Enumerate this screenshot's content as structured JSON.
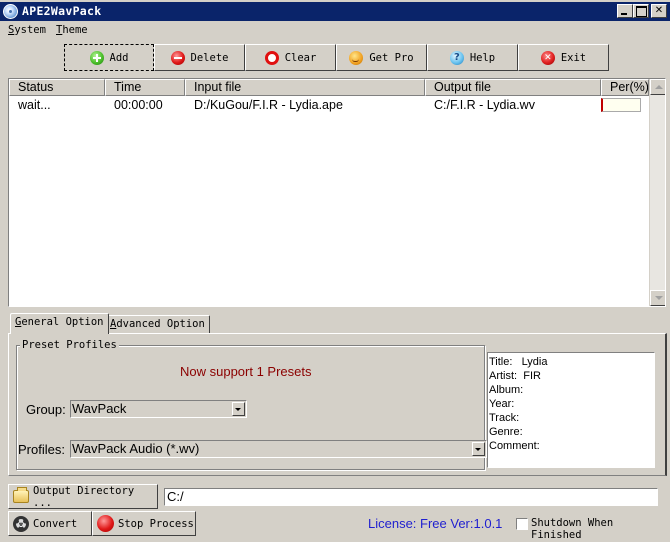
{
  "window": {
    "title": "APE2WavPack",
    "controls": {
      "minimize": "",
      "maximize": "",
      "close": "✕"
    }
  },
  "menu": [
    {
      "label": "System",
      "accel": "S",
      "rest": "ystem"
    },
    {
      "label": "Theme",
      "accel": "T",
      "rest": "heme"
    }
  ],
  "toolbar": {
    "buttons": [
      {
        "label": "Add",
        "icon": "add-icon"
      },
      {
        "label": "Delete",
        "icon": "delete-icon"
      },
      {
        "label": "Clear",
        "icon": "clear-icon"
      },
      {
        "label": "Get Pro",
        "icon": "smiley-icon"
      },
      {
        "label": "Help",
        "icon": "help-icon",
        "glyph": "?"
      },
      {
        "label": "Exit",
        "icon": "exit-icon",
        "glyph": "✕"
      }
    ]
  },
  "file_list": {
    "columns": [
      "Status",
      "Time",
      "Input file",
      "Output file",
      "Per(%)"
    ],
    "rows": [
      {
        "status": "wait...",
        "time": "00:00:00",
        "input": "D:/KuGou/F.I.R - Lydia.ape",
        "output": "C:/F.I.R - Lydia.wv",
        "percent": 0
      }
    ]
  },
  "tabs": [
    {
      "label": "General Option",
      "accel": "G",
      "rest": "eneral Option",
      "active": true
    },
    {
      "label": "Advanced Option",
      "accel": "A",
      "rest": "dvanced Option",
      "active": false
    }
  ],
  "presets": {
    "group_label": "Preset Profiles",
    "note": "Now support 1 Presets",
    "group_field_label": "Group:",
    "group_value": "WavPack",
    "profiles_field_label": "Profiles:",
    "profiles_value": "WavPack Audio (*.wv)"
  },
  "metadata": {
    "lines": [
      "Title:   Lydia",
      "Artist:  FIR",
      "Album:",
      "Year:",
      "Track:",
      "Genre:",
      "Comment:"
    ]
  },
  "bottom": {
    "output_dir_button": "Output Directory ...",
    "output_dir_value": "C:/",
    "convert_button": "Convert",
    "stop_button": "Stop Process",
    "license": "License: Free Ver:1.0.1",
    "shutdown_label": "Shutdown When Finished",
    "shutdown_checked": false
  }
}
